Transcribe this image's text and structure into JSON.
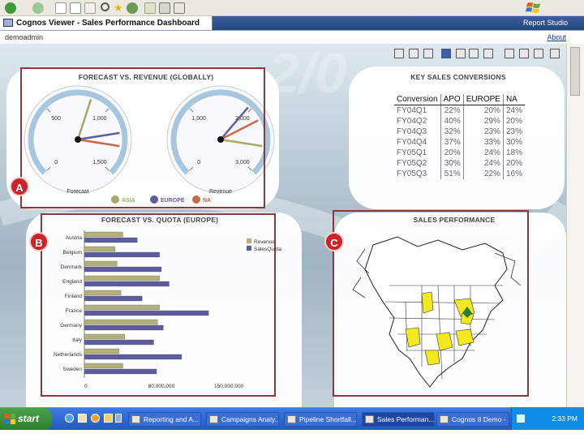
{
  "browser": {
    "toolbar_icons": [
      "back-icon",
      "forward-icon",
      "stop-icon",
      "refresh-icon",
      "home-icon",
      "search-icon",
      "favorites-icon",
      "history-icon",
      "mail-icon",
      "print-icon",
      "edit-icon"
    ]
  },
  "window": {
    "title": "Cognos Viewer - Sales Performance Dashboard",
    "report_studio_label": "Report Studio"
  },
  "user_bar": {
    "user": "demoadmin",
    "about": "About"
  },
  "panels": {
    "forecast_vs_revenue": {
      "title": "FORECAST VS. REVENUE (GLOBALLY)",
      "callout": "A"
    },
    "key_sales_conversions": {
      "title": "KEY SALES CONVERSIONS"
    },
    "forecast_vs_quota": {
      "title": "FORECAST VS. QUOTA (EUROPE)",
      "callout": "B"
    },
    "sales_performance": {
      "title": "SALES PERFORMANCE",
      "callout": "C"
    }
  },
  "chart_data": [
    {
      "type": "gauge",
      "title": "FORECAST VS. REVENUE (GLOBALLY)",
      "gauges": [
        {
          "label": "Forecast",
          "ticks": [
            "0",
            "500",
            "1,000",
            "1,500"
          ],
          "min": 0,
          "max": 1500,
          "values": {
            "ASIA": 850,
            "EUROPE": 1200,
            "NA": 1300
          }
        },
        {
          "label": "Revenue",
          "ticks": [
            "0",
            "1,000",
            "2,000",
            "3,000"
          ],
          "min": 0,
          "max": 3000,
          "values": {
            "ASIA": 2600,
            "EUROPE": 1950,
            "NA": 2200
          }
        }
      ],
      "legend": [
        {
          "name": "ASIA",
          "color": "#a9a866"
        },
        {
          "name": "EUROPE",
          "color": "#5f5d9c"
        },
        {
          "name": "NA",
          "color": "#c9694a"
        }
      ]
    },
    {
      "type": "table",
      "title": "KEY SALES CONVERSIONS",
      "columns": [
        "Conversion",
        "APO",
        "EUROPE",
        "NA"
      ],
      "rows": [
        [
          "FY04Q1",
          "22%",
          "20%",
          "24%"
        ],
        [
          "FY04Q2",
          "40%",
          "29%",
          "20%"
        ],
        [
          "FY04Q3",
          "32%",
          "23%",
          "23%"
        ],
        [
          "FY04Q4",
          "37%",
          "33%",
          "30%"
        ],
        [
          "FY05Q1",
          "20%",
          "24%",
          "18%"
        ],
        [
          "FY05Q2",
          "30%",
          "24%",
          "20%"
        ],
        [
          "FY05Q3",
          "51%",
          "22%",
          "16%"
        ]
      ]
    },
    {
      "type": "bar",
      "orientation": "horizontal",
      "title": "FORECAST VS. QUOTA (EUROPE)",
      "categories": [
        "Austria",
        "Belgium",
        "Denmark",
        "England",
        "Finland",
        "France",
        "Germany",
        "Italy",
        "Netherlands",
        "Sweden"
      ],
      "series": [
        {
          "name": "Revenue",
          "color": "#b3b17a",
          "values": [
            40000000,
            32000000,
            34000000,
            78000000,
            38000000,
            78000000,
            76000000,
            42000000,
            36000000,
            40000000
          ]
        },
        {
          "name": "SalesQuota",
          "color": "#5e5b9e",
          "values": [
            55000000,
            78000000,
            80000000,
            88000000,
            60000000,
            129000000,
            82000000,
            72000000,
            101000000,
            75000000
          ]
        }
      ],
      "x_ticks": [
        "0",
        "80,000,000",
        "150,000,000"
      ],
      "xlim": [
        0,
        160000000
      ],
      "legend_position": "right"
    },
    {
      "type": "map",
      "title": "SALES PERFORMANCE",
      "region": "North America",
      "highlight_color": "#f2ea1f"
    }
  ],
  "taskbar": {
    "start": "start",
    "quick_launch_icons": [
      "ie-icon",
      "mail-icon",
      "media-icon",
      "explorer-icon",
      "desktop-icon"
    ],
    "items": [
      {
        "label": "Reporting and A...",
        "active": false
      },
      {
        "label": "Campaigns Analy...",
        "active": false
      },
      {
        "label": "Pipeline Shortfall...",
        "active": false
      },
      {
        "label": "Sales Performan...",
        "active": true
      },
      {
        "label": "Cognos 8 Demo - ...",
        "active": false
      }
    ],
    "clock": "2:33 PM"
  }
}
